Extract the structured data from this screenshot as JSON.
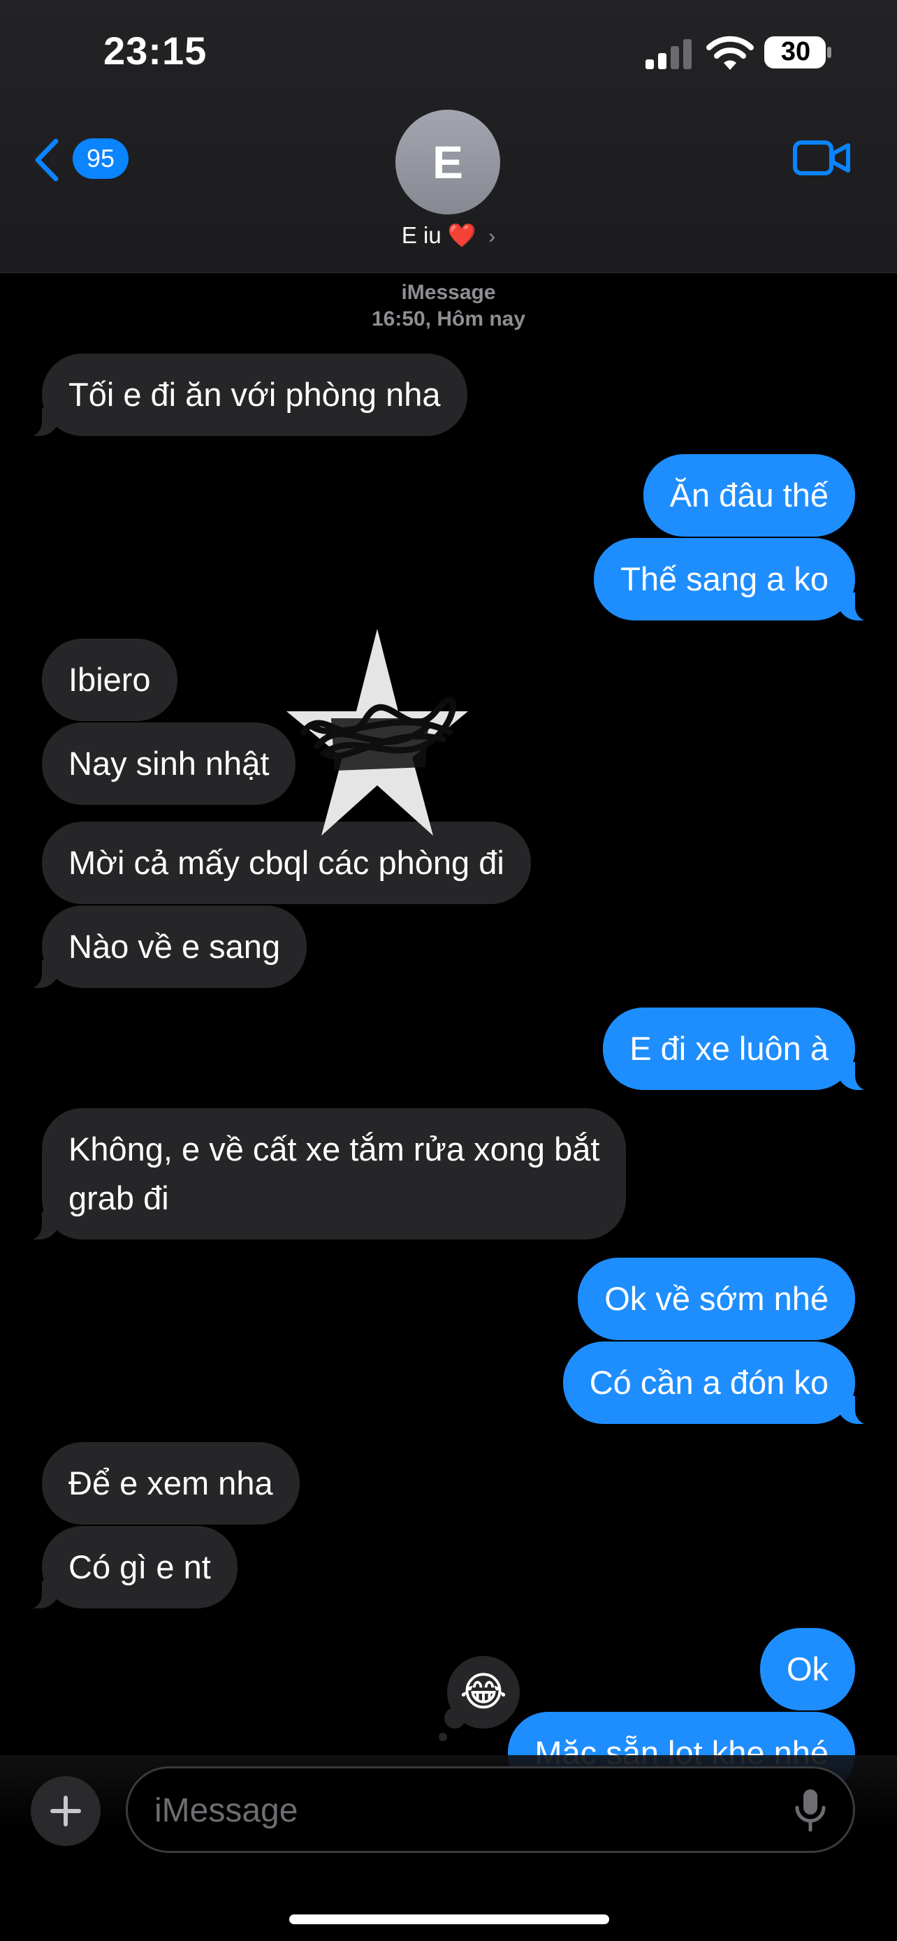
{
  "status_bar": {
    "time": "23:15",
    "battery_level": "30"
  },
  "header": {
    "back_count": "95",
    "avatar_initial": "E",
    "contact_name": "E iu",
    "contact_emoji": "❤️",
    "chevron": "›"
  },
  "thread": {
    "service": "iMessage",
    "timestamp": "16:50, Hôm nay",
    "messages": [
      {
        "dir": "in",
        "text": "Tối e đi ăn với phòng nha"
      },
      {
        "dir": "out",
        "text": "Ăn đâu thế"
      },
      {
        "dir": "out",
        "text": "Thế sang a ko"
      },
      {
        "dir": "in",
        "text": "Ibiero"
      },
      {
        "dir": "in",
        "text": "Nay sinh nhật"
      },
      {
        "dir": "in",
        "text": "Mời cả mấy cbql các phòng đi"
      },
      {
        "dir": "in",
        "text": "Nào về e sang"
      },
      {
        "dir": "out",
        "text": "E đi xe luôn à"
      },
      {
        "dir": "in",
        "text": "Không, e về cất xe tắm rửa xong bắt\ngrab đi"
      },
      {
        "dir": "out",
        "text": "Ok về sớm nhé"
      },
      {
        "dir": "out",
        "text": "Có cần a đón ko"
      },
      {
        "dir": "in",
        "text": "Để e xem nha"
      },
      {
        "dir": "in",
        "text": "Có gì e nt"
      },
      {
        "dir": "out",
        "text": "Ok"
      },
      {
        "dir": "out",
        "text": "Mặc sẵn lọt khe nhé"
      }
    ],
    "reaction_emoji": "😂"
  },
  "composer": {
    "placeholder": "iMessage"
  },
  "icons": {
    "back": "chevron-left-icon",
    "video": "video-camera-icon",
    "plus": "plus-icon",
    "mic": "microphone-icon",
    "signal": "cellular-signal-icon",
    "wifi": "wifi-icon",
    "battery": "battery-icon"
  },
  "colors": {
    "accent": "#0a84ff",
    "outgoing_bubble": "#1e8eff",
    "incoming_bubble": "#262628"
  }
}
